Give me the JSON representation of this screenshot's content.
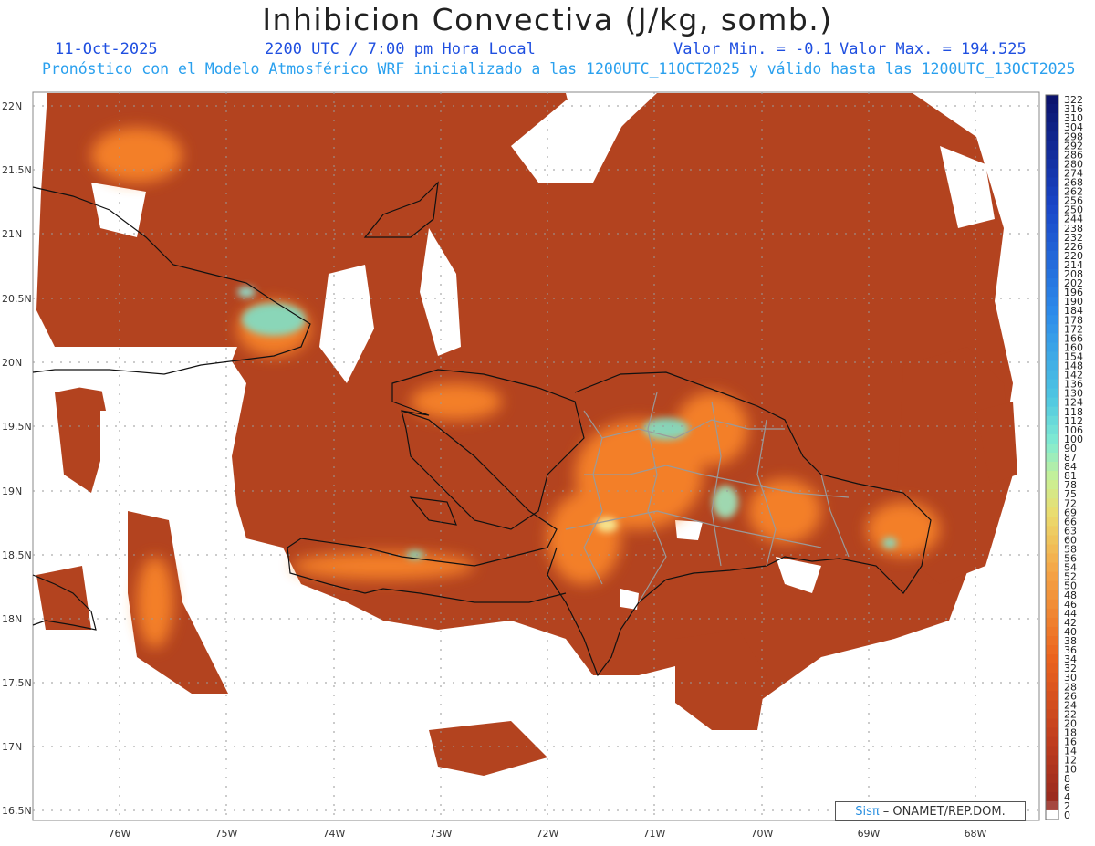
{
  "title": "Inhibicion Convectiva (J/kg, somb.)",
  "header": {
    "date": "11-Oct-2025",
    "time": "2200 UTC / 7:00 pm Hora Local",
    "vmin": "Valor Min. = -0.1",
    "vmax": "Valor Max. = 194.525",
    "subtitle": "Pronóstico con el Modelo Atmosférico WRF inicializado a las 1200UTC_11OCT2025 y válido hasta las  1200UTC_13OCT2025"
  },
  "map": {
    "lat_labels": [
      "22N",
      "21.5N",
      "21N",
      "20.5N",
      "20N",
      "19.5N",
      "19N",
      "18.5N",
      "18N",
      "17.5N",
      "17N",
      "16.5N"
    ],
    "lon_labels": [
      "76W",
      "75W",
      "74W",
      "73W",
      "72W",
      "71W",
      "70W",
      "69W",
      "68W"
    ],
    "colorbar_labels": [
      "322",
      "316",
      "310",
      "304",
      "298",
      "292",
      "286",
      "280",
      "274",
      "268",
      "262",
      "256",
      "250",
      "244",
      "238",
      "232",
      "226",
      "220",
      "214",
      "208",
      "202",
      "196",
      "190",
      "184",
      "178",
      "172",
      "166",
      "160",
      "154",
      "148",
      "142",
      "136",
      "130",
      "124",
      "118",
      "112",
      "106",
      "100",
      "90",
      "87",
      "84",
      "81",
      "78",
      "75",
      "72",
      "69",
      "66",
      "63",
      "60",
      "58",
      "56",
      "54",
      "52",
      "50",
      "48",
      "46",
      "44",
      "42",
      "40",
      "38",
      "36",
      "34",
      "32",
      "30",
      "28",
      "26",
      "24",
      "22",
      "20",
      "18",
      "16",
      "14",
      "12",
      "10",
      "8",
      "6",
      "4",
      "2",
      "0"
    ],
    "colors": {
      "field": "#b5441e",
      "high": "#ff8a2a",
      "peak": "#7fe0c8",
      "ocean": "#ffffff"
    }
  },
  "credit": {
    "brand": "Sisπ",
    "org": "– ONAMET/REP.DOM."
  }
}
